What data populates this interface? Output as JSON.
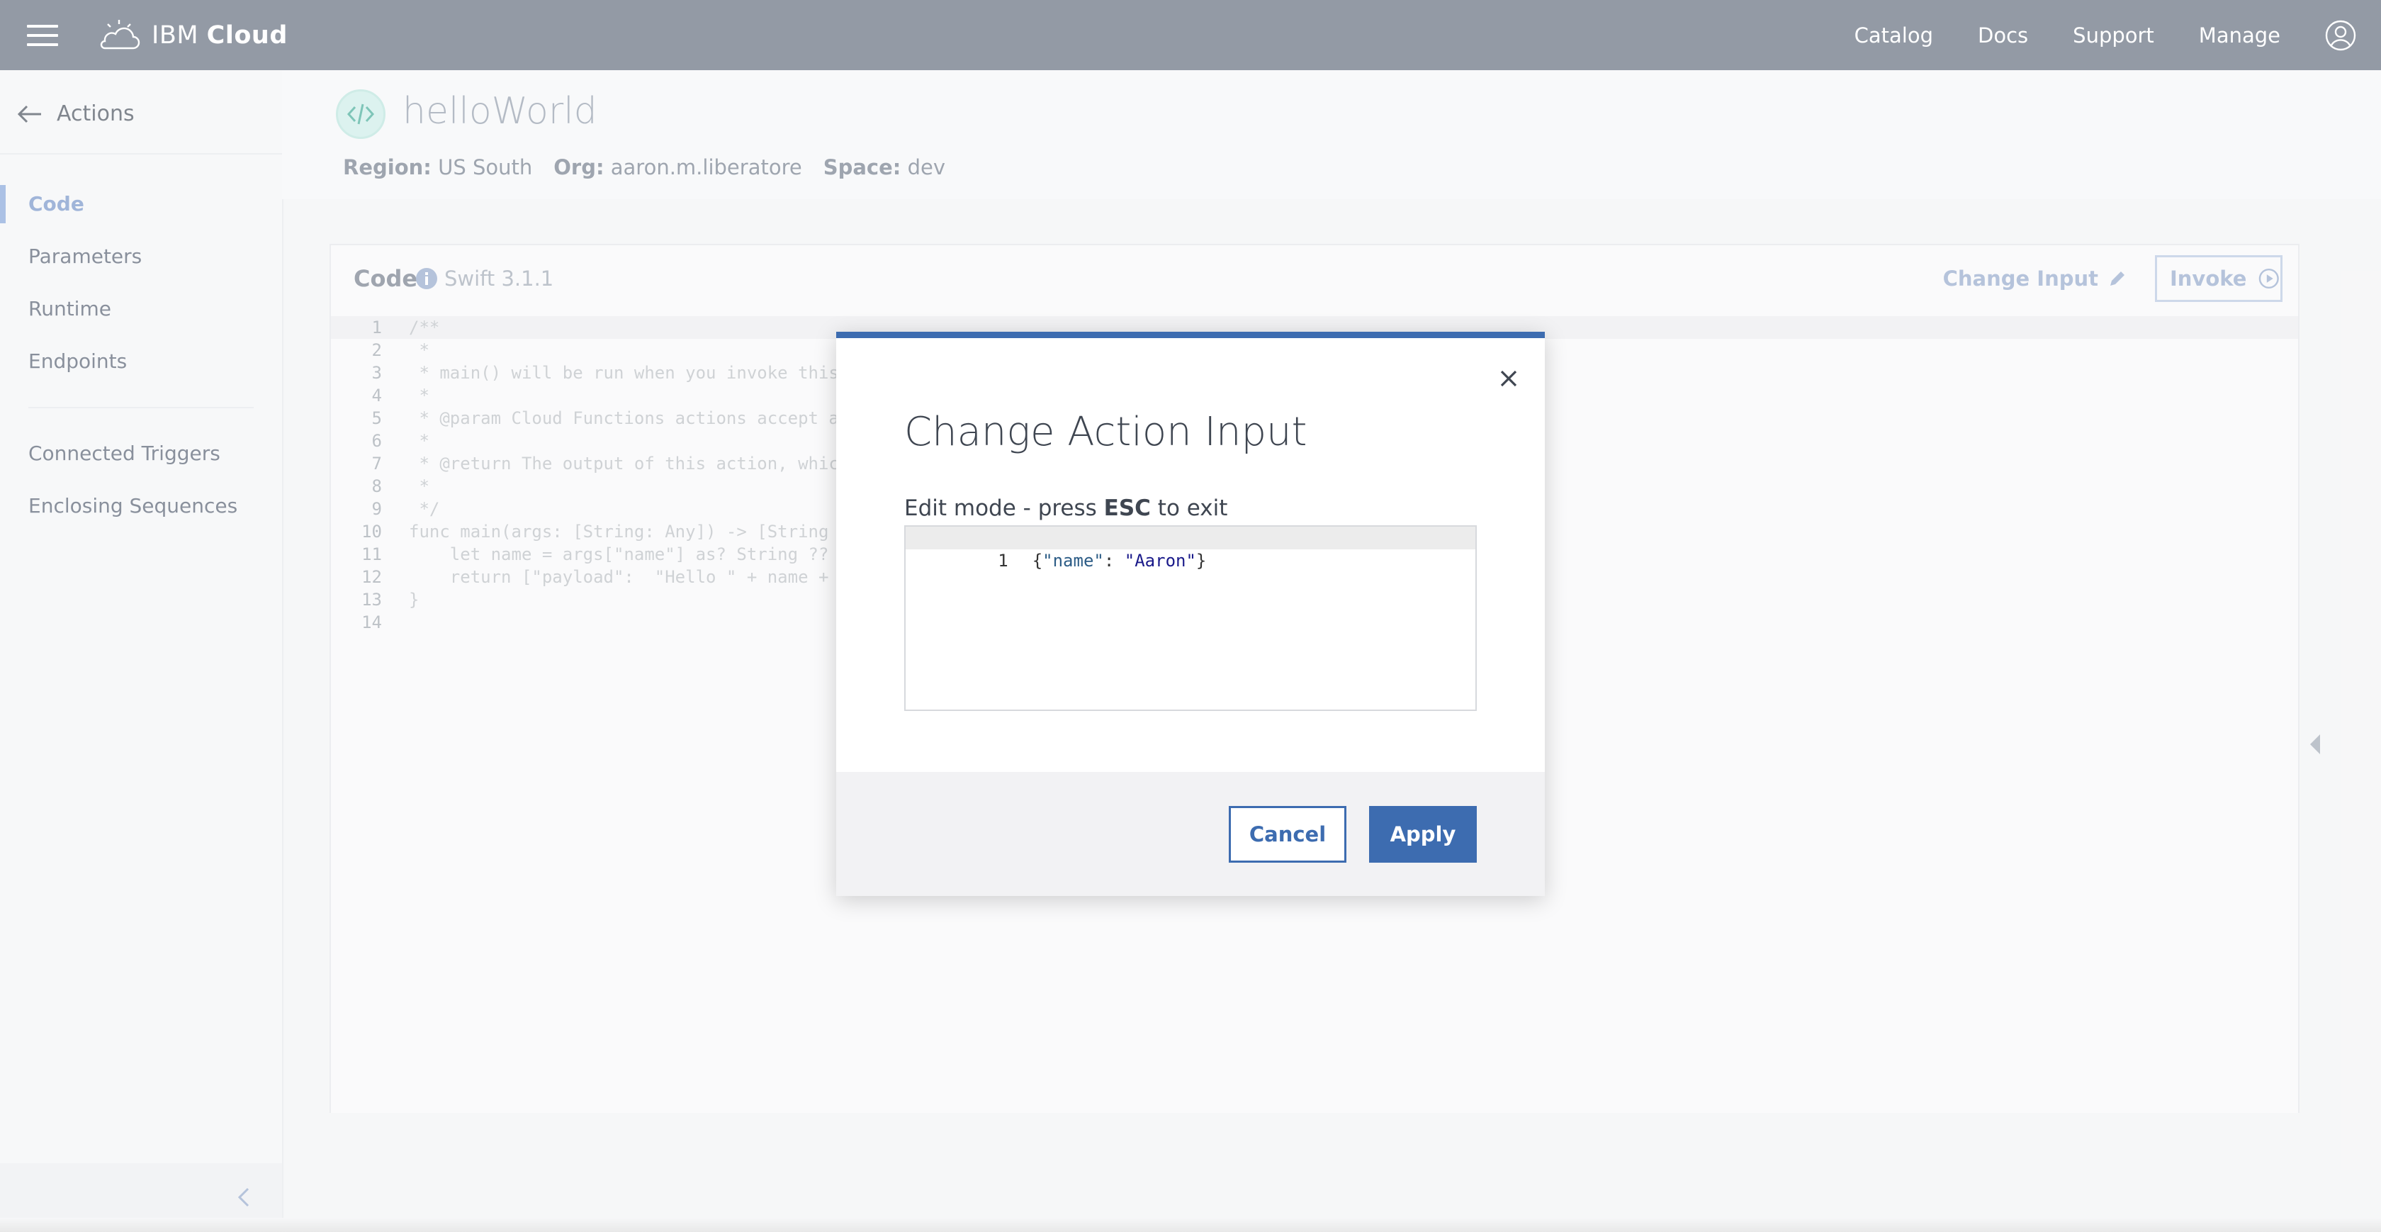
{
  "topbar": {
    "brand_prefix": "IBM",
    "brand_bold": "Cloud",
    "nav": [
      "Catalog",
      "Docs",
      "Support",
      "Manage"
    ]
  },
  "sidebar": {
    "back_label": "Actions",
    "items": [
      {
        "label": "Code",
        "active": true
      },
      {
        "label": "Parameters",
        "active": false
      },
      {
        "label": "Runtime",
        "active": false
      },
      {
        "label": "Endpoints",
        "active": false
      }
    ],
    "items2": [
      {
        "label": "Connected Triggers"
      },
      {
        "label": "Enclosing Sequences"
      }
    ]
  },
  "header": {
    "title": "helloWorld",
    "region_label": "Region:",
    "region_value": "US South",
    "org_label": "Org:",
    "org_value": "aaron.m.liberatore",
    "space_label": "Space:",
    "space_value": "dev"
  },
  "code_card": {
    "title": "Code",
    "runtime": "Swift 3.1.1",
    "change_input_label": "Change Input",
    "invoke_label": "Invoke",
    "lines": [
      {
        "n": "1",
        "text": "/**"
      },
      {
        "n": "2",
        "text": " *"
      },
      {
        "n": "3",
        "text": " * main() will be run when you invoke this"
      },
      {
        "n": "4",
        "text": " *"
      },
      {
        "n": "5",
        "text": " * @param Cloud Functions actions accept a"
      },
      {
        "n": "6",
        "text": " *"
      },
      {
        "n": "7",
        "text": " * @return The output of this action, whic"
      },
      {
        "n": "8",
        "text": " *"
      },
      {
        "n": "9",
        "text": " */"
      },
      {
        "n": "10",
        "text": "func main(args: [String: Any]) -> [String"
      },
      {
        "n": "11",
        "text": "    let name = args[\"name\"] as? String ??"
      },
      {
        "n": "12",
        "text": "    return [\"payload\":  \"Hello \" + name +"
      },
      {
        "n": "13",
        "text": "}"
      },
      {
        "n": "14",
        "text": ""
      }
    ]
  },
  "modal": {
    "title": "Change Action Input",
    "hint_prefix": "Edit mode - press",
    "hint_key": "ESC",
    "hint_suffix": "to exit",
    "editor_line_number": "1",
    "json_open": "{",
    "json_key": "\"name\"",
    "json_colon": ": ",
    "json_value": "\"Aaron\"",
    "json_close": "}",
    "cancel_label": "Cancel",
    "apply_label": "Apply"
  },
  "icons": {
    "menu": "hamburger-icon",
    "brand": "ibm-cloud-logo-icon",
    "user": "user-avatar-icon",
    "back": "arrow-left-icon",
    "action": "code-icon",
    "info": "info-icon",
    "edit": "pencil-icon",
    "play": "play-circle-icon",
    "close": "close-icon",
    "collapse": "chevron-left-icon"
  },
  "colors": {
    "topbar": "#5a6575",
    "accent": "#3d6cb0",
    "sidebar_active": "#7fa0d8"
  }
}
